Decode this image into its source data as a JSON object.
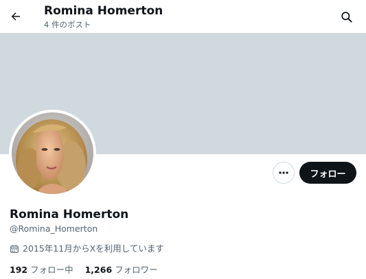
{
  "header": {
    "title": "Romina Homerton",
    "post_count": "4 件のポスト",
    "back_icon": "arrow-left-icon",
    "search_icon": "search-icon"
  },
  "profile": {
    "display_name": "Romina Homerton",
    "handle": "@Romina_Homerton",
    "joined": "2015年11月からXを利用しています",
    "joined_icon": "calendar-icon",
    "following_count": "192",
    "following_label": "フォロー中",
    "followers_count": "1,266",
    "followers_label": "フォロワー"
  },
  "actions": {
    "follow_label": "フォロー",
    "more_icon": "more-icon"
  },
  "colors": {
    "banner": "#cfd9de",
    "text_primary": "#0f1419",
    "text_secondary": "#536471",
    "button_dark": "#0f1419"
  }
}
